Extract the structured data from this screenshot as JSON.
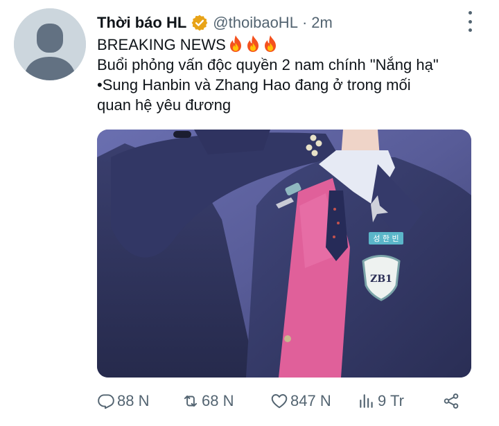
{
  "tweet": {
    "display_name": "Thời báo HL",
    "handle": "@thoibaoHL",
    "separator": "·",
    "time": "2m",
    "lines": [
      "BREAKING NEWS",
      "Buổi phỏng vấn độc quyền 2 nam chính \"Nắng hạ\"",
      "•Sung Hanbin và Zhang Hao đang ở trong mối",
      "quan hệ yêu đương"
    ],
    "media": {
      "name_tag_text": "성 한 빈",
      "emblem_text": "ZB1"
    }
  },
  "actions": {
    "replies": "88 N",
    "retweets": "68 N",
    "likes": "847 N",
    "views": "9 Tr"
  },
  "icons": {
    "verified": "verified-badge-icon",
    "fire": "fire-emoji-icon",
    "reply": "reply-icon",
    "retweet": "retweet-icon",
    "like": "heart-icon",
    "views": "views-icon",
    "share": "share-icon",
    "more": "more-vertical-icon"
  },
  "colors": {
    "verified_gold": "#e8a317",
    "text_primary": "#0f1419",
    "text_secondary": "#536471",
    "avatar_bg": "#ccd6dd"
  }
}
